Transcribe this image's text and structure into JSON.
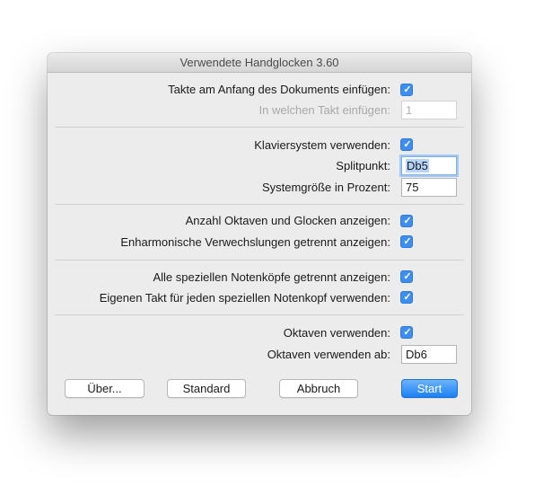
{
  "window": {
    "title": "Verwendete Handglocken 3.60"
  },
  "rows": {
    "takte_einfuegen": {
      "label": "Takte am Anfang des Dokuments einfügen:",
      "checked": true
    },
    "in_welchen_takt": {
      "label": "In welchen Takt einfügen:",
      "value": "1"
    },
    "klaviersystem": {
      "label": "Klaviersystem verwenden:",
      "checked": true
    },
    "splitpunkt": {
      "label": "Splitpunkt:",
      "value": "Db5"
    },
    "systemgroesse": {
      "label": "Systemgröße in Prozent:",
      "value": "75"
    },
    "anzahl_oktaven": {
      "label": "Anzahl Oktaven und Glocken anzeigen:",
      "checked": true
    },
    "enharmonische": {
      "label": "Enharmonische Verwechslungen getrennt anzeigen:",
      "checked": true
    },
    "notenkoepfe": {
      "label": "Alle speziellen Notenköpfe getrennt anzeigen:",
      "checked": true
    },
    "eigener_takt": {
      "label": "Eigenen Takt für jeden speziellen Notenkopf verwenden:",
      "checked": true
    },
    "oktaven_verwenden": {
      "label": "Oktaven verwenden:",
      "checked": true
    },
    "oktaven_ab": {
      "label": "Oktaven verwenden ab:",
      "value": "Db6"
    }
  },
  "buttons": {
    "ueber": "Über...",
    "standard": "Standard",
    "abbruch": "Abbruch",
    "start": "Start"
  },
  "checkmark_glyph": "✓",
  "colors": {
    "accent": "#3d8ef0",
    "primary_button": "#1c80f4"
  }
}
